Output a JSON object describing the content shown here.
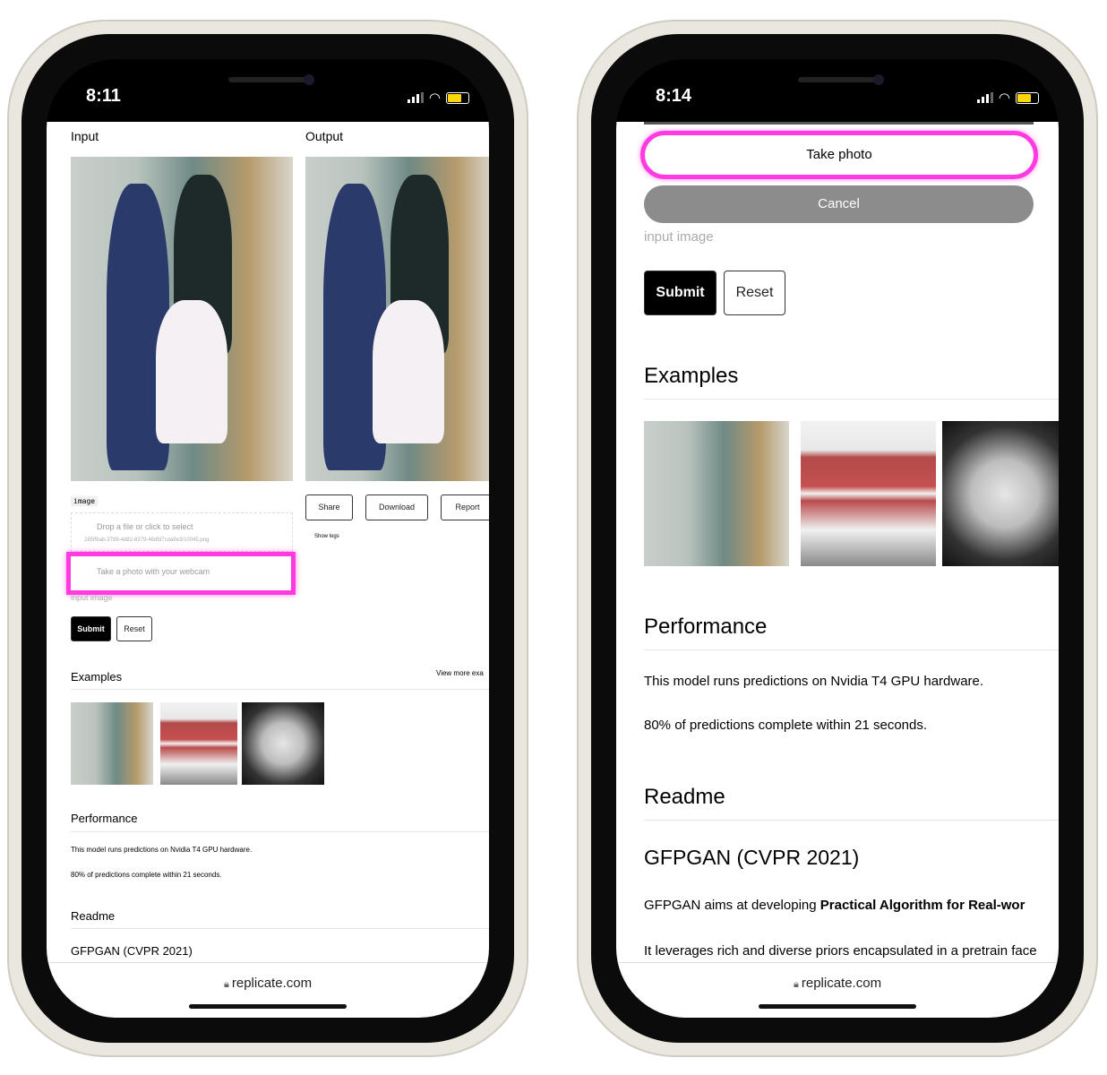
{
  "left": {
    "time": "8:11",
    "input_label": "Input",
    "output_label": "Output",
    "field_tag": "image",
    "drop_text": "Drop a file or click to select",
    "file_name": "285ff8ab-3789-4d82-8379-46dfd7cda9e3/10045.png",
    "webcam_text": "Take a photo with your webcam",
    "input_image_label": "input image",
    "submit": "Submit",
    "reset": "Reset",
    "share": "Share",
    "download": "Download",
    "report": "Report",
    "show_logs": "Show logs",
    "examples": "Examples",
    "view_more": "View more exa",
    "performance": "Performance",
    "perf_line1": "This model runs predictions on Nvidia T4 GPU hardware.",
    "perf_line2": "80% of predictions complete within 21 seconds.",
    "readme": "Readme",
    "gfpgan": "GFPGAN (CVPR 2021)",
    "url": "replicate.com"
  },
  "right": {
    "time": "8:14",
    "take_photo": "Take photo",
    "cancel": "Cancel",
    "input_image_label": "input image",
    "submit": "Submit",
    "reset": "Reset",
    "examples": "Examples",
    "performance": "Performance",
    "perf_line1": "This model runs predictions on Nvidia T4 GPU hardware.",
    "perf_line2": "80% of predictions complete within 21 seconds.",
    "readme": "Readme",
    "gfpgan": "GFPGAN (CVPR 2021)",
    "readme_p1_start": "GFPGAN aims at developing ",
    "readme_p1_bold": "Practical Algorithm for Real-wor",
    "readme_p2": "It leverages rich and diverse priors encapsulated in a pretrain face restoration.",
    "url": "replicate.com"
  },
  "colors": {
    "highlight": "#ff3ae0",
    "battery": "#ffd60a",
    "cancel_bg": "#8c8c8c"
  }
}
